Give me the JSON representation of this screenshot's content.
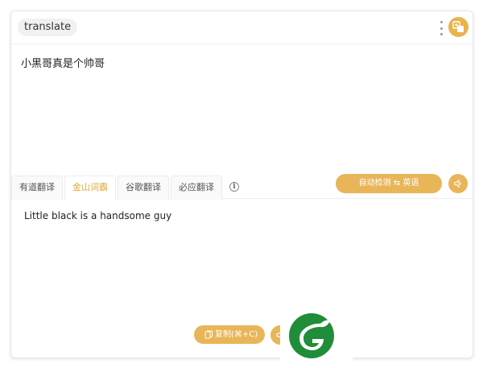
{
  "app": {
    "title": "translate"
  },
  "source": {
    "text": "小黑哥真是个帅哥"
  },
  "tabs": [
    {
      "label": "有道翻译",
      "active": false
    },
    {
      "label": "金山词霸",
      "active": true
    },
    {
      "label": "谷歌翻译",
      "active": false
    },
    {
      "label": "必应翻译",
      "active": false
    }
  ],
  "language_button": {
    "label": "自动检测 ⇆ 英语"
  },
  "result": {
    "text": "Little black is a handsome guy"
  },
  "copy_button": {
    "label": "复制(⌘+C)"
  },
  "colors": {
    "accent": "#e8b659",
    "active_tab": "#e2a83e",
    "logo_green": "#1f8d3a"
  },
  "icons": {
    "menu": "more-vertical-icon",
    "brand": "translate-icon",
    "info": "info-icon",
    "speaker": "speaker-icon",
    "copy": "copy-icon",
    "logo": "leaf-logo"
  }
}
